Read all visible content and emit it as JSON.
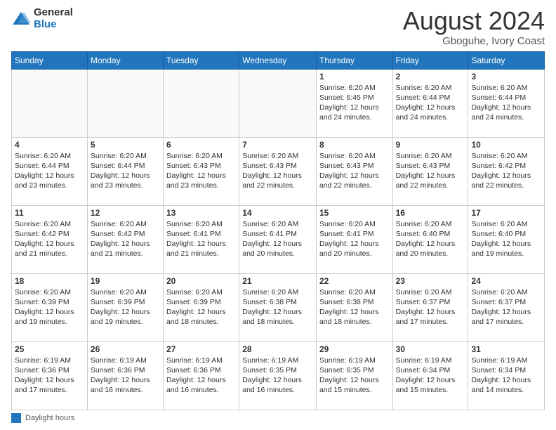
{
  "logo": {
    "general": "General",
    "blue": "Blue"
  },
  "header": {
    "month": "August 2024",
    "location": "Gboguhe, Ivory Coast"
  },
  "days_of_week": [
    "Sunday",
    "Monday",
    "Tuesday",
    "Wednesday",
    "Thursday",
    "Friday",
    "Saturday"
  ],
  "legend": {
    "label": "Daylight hours"
  },
  "weeks": [
    [
      {
        "day": "",
        "info": ""
      },
      {
        "day": "",
        "info": ""
      },
      {
        "day": "",
        "info": ""
      },
      {
        "day": "",
        "info": ""
      },
      {
        "day": "1",
        "info": "Sunrise: 6:20 AM\nSunset: 6:45 PM\nDaylight: 12 hours\nand 24 minutes."
      },
      {
        "day": "2",
        "info": "Sunrise: 6:20 AM\nSunset: 6:44 PM\nDaylight: 12 hours\nand 24 minutes."
      },
      {
        "day": "3",
        "info": "Sunrise: 6:20 AM\nSunset: 6:44 PM\nDaylight: 12 hours\nand 24 minutes."
      }
    ],
    [
      {
        "day": "4",
        "info": "Sunrise: 6:20 AM\nSunset: 6:44 PM\nDaylight: 12 hours\nand 23 minutes."
      },
      {
        "day": "5",
        "info": "Sunrise: 6:20 AM\nSunset: 6:44 PM\nDaylight: 12 hours\nand 23 minutes."
      },
      {
        "day": "6",
        "info": "Sunrise: 6:20 AM\nSunset: 6:43 PM\nDaylight: 12 hours\nand 23 minutes."
      },
      {
        "day": "7",
        "info": "Sunrise: 6:20 AM\nSunset: 6:43 PM\nDaylight: 12 hours\nand 22 minutes."
      },
      {
        "day": "8",
        "info": "Sunrise: 6:20 AM\nSunset: 6:43 PM\nDaylight: 12 hours\nand 22 minutes."
      },
      {
        "day": "9",
        "info": "Sunrise: 6:20 AM\nSunset: 6:43 PM\nDaylight: 12 hours\nand 22 minutes."
      },
      {
        "day": "10",
        "info": "Sunrise: 6:20 AM\nSunset: 6:42 PM\nDaylight: 12 hours\nand 22 minutes."
      }
    ],
    [
      {
        "day": "11",
        "info": "Sunrise: 6:20 AM\nSunset: 6:42 PM\nDaylight: 12 hours\nand 21 minutes."
      },
      {
        "day": "12",
        "info": "Sunrise: 6:20 AM\nSunset: 6:42 PM\nDaylight: 12 hours\nand 21 minutes."
      },
      {
        "day": "13",
        "info": "Sunrise: 6:20 AM\nSunset: 6:41 PM\nDaylight: 12 hours\nand 21 minutes."
      },
      {
        "day": "14",
        "info": "Sunrise: 6:20 AM\nSunset: 6:41 PM\nDaylight: 12 hours\nand 20 minutes."
      },
      {
        "day": "15",
        "info": "Sunrise: 6:20 AM\nSunset: 6:41 PM\nDaylight: 12 hours\nand 20 minutes."
      },
      {
        "day": "16",
        "info": "Sunrise: 6:20 AM\nSunset: 6:40 PM\nDaylight: 12 hours\nand 20 minutes."
      },
      {
        "day": "17",
        "info": "Sunrise: 6:20 AM\nSunset: 6:40 PM\nDaylight: 12 hours\nand 19 minutes."
      }
    ],
    [
      {
        "day": "18",
        "info": "Sunrise: 6:20 AM\nSunset: 6:39 PM\nDaylight: 12 hours\nand 19 minutes."
      },
      {
        "day": "19",
        "info": "Sunrise: 6:20 AM\nSunset: 6:39 PM\nDaylight: 12 hours\nand 19 minutes."
      },
      {
        "day": "20",
        "info": "Sunrise: 6:20 AM\nSunset: 6:39 PM\nDaylight: 12 hours\nand 18 minutes."
      },
      {
        "day": "21",
        "info": "Sunrise: 6:20 AM\nSunset: 6:38 PM\nDaylight: 12 hours\nand 18 minutes."
      },
      {
        "day": "22",
        "info": "Sunrise: 6:20 AM\nSunset: 6:38 PM\nDaylight: 12 hours\nand 18 minutes."
      },
      {
        "day": "23",
        "info": "Sunrise: 6:20 AM\nSunset: 6:37 PM\nDaylight: 12 hours\nand 17 minutes."
      },
      {
        "day": "24",
        "info": "Sunrise: 6:20 AM\nSunset: 6:37 PM\nDaylight: 12 hours\nand 17 minutes."
      }
    ],
    [
      {
        "day": "25",
        "info": "Sunrise: 6:19 AM\nSunset: 6:36 PM\nDaylight: 12 hours\nand 17 minutes."
      },
      {
        "day": "26",
        "info": "Sunrise: 6:19 AM\nSunset: 6:36 PM\nDaylight: 12 hours\nand 16 minutes."
      },
      {
        "day": "27",
        "info": "Sunrise: 6:19 AM\nSunset: 6:36 PM\nDaylight: 12 hours\nand 16 minutes."
      },
      {
        "day": "28",
        "info": "Sunrise: 6:19 AM\nSunset: 6:35 PM\nDaylight: 12 hours\nand 16 minutes."
      },
      {
        "day": "29",
        "info": "Sunrise: 6:19 AM\nSunset: 6:35 PM\nDaylight: 12 hours\nand 15 minutes."
      },
      {
        "day": "30",
        "info": "Sunrise: 6:19 AM\nSunset: 6:34 PM\nDaylight: 12 hours\nand 15 minutes."
      },
      {
        "day": "31",
        "info": "Sunrise: 6:19 AM\nSunset: 6:34 PM\nDaylight: 12 hours\nand 14 minutes."
      }
    ]
  ]
}
